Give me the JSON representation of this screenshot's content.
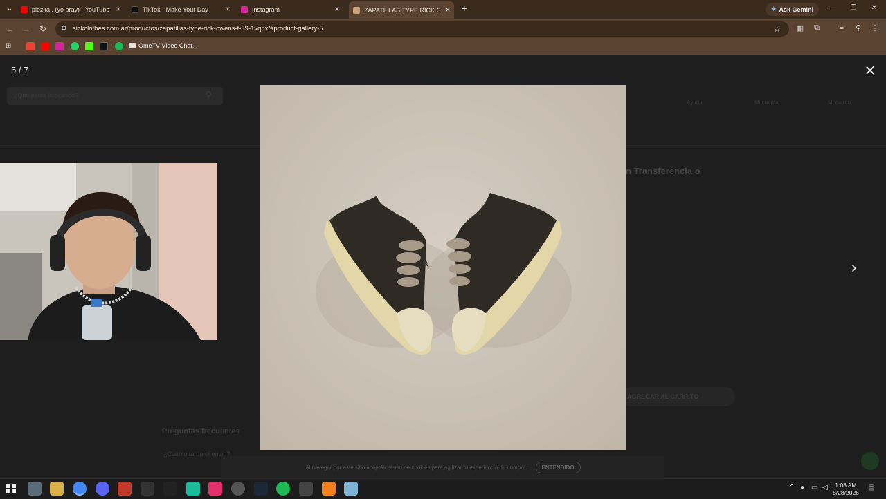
{
  "browser": {
    "tabs": [
      {
        "title": "piezita . (yo pray) - YouTube",
        "icon": "youtube-icon",
        "color": "#ff0000"
      },
      {
        "title": "TikTok - Make Your Day",
        "icon": "tiktok-icon",
        "color": "#111111"
      },
      {
        "title": "Instagram",
        "icon": "instagram-icon",
        "color": "#d6249f"
      },
      {
        "title": "ZAPATILLAS TYPE RICK OWENS",
        "icon": "sickclothes-icon",
        "color": "#c9a27a"
      }
    ],
    "active_tab_index": 3,
    "new_tab": "+",
    "gemini_label": "Ask Gemini",
    "url": "sickclothes.com.ar/productos/zapatillas-type-rick-owens-t-39-1vqnx/#product-gallery-5",
    "bookmarks": [
      {
        "name": "gmail-bookmark",
        "color": "#ea4335"
      },
      {
        "name": "youtube-bookmark",
        "color": "#ff0000"
      },
      {
        "name": "instagram-bookmark",
        "color": "#d6249f"
      },
      {
        "name": "whatsapp-bookmark",
        "color": "#25d366"
      },
      {
        "name": "kick-bookmark",
        "color": "#53fc18"
      },
      {
        "name": "tiktok-bookmark",
        "color": "#111111"
      },
      {
        "name": "spotify-bookmark",
        "color": "#1db954"
      }
    ],
    "bookmark_ometv": "OmeTV Video Chat..."
  },
  "page_ghost": {
    "search_placeholder": "¿Qué estás buscando?",
    "help": "Ayuda",
    "account": "Mi cuenta",
    "cart": "Mi carrito",
    "transfer": "n Transferencia o",
    "add_to_cart": "AGREGAR AL CARRITO",
    "faq": "Preguntas frecuentes",
    "faq_q1": "¿Cuánto tarda el envío?"
  },
  "gallery": {
    "counter": "5 / 7",
    "close": "✕",
    "next": "›"
  },
  "cookie_bar": {
    "text": "Al navegar por este sitio aceptás el uso de cookies para agilizar tu experiencia de compra.",
    "button": "ENTENDIDO"
  },
  "taskbar": {
    "time": "1:08 AM",
    "date": "8/28/2026",
    "apps": [
      {
        "name": "start-button",
        "color": "#3aa0ff"
      },
      {
        "name": "file-explorer-app",
        "color": "#d9b04a"
      },
      {
        "name": "chrome-app",
        "color": "#4285f4"
      },
      {
        "name": "discord-app",
        "color": "#5865f2"
      },
      {
        "name": "voicemeeter-app",
        "color": "#c0392b"
      },
      {
        "name": "epic-games-app",
        "color": "#333333"
      },
      {
        "name": "capcut-app",
        "color": "#222222"
      },
      {
        "name": "tiktok-live-app",
        "color": "#1abc9c"
      },
      {
        "name": "tiktok-app",
        "color": "#e1306c"
      },
      {
        "name": "obs-app",
        "color": "#555555"
      },
      {
        "name": "steam-app",
        "color": "#1b2838"
      },
      {
        "name": "spotify-app",
        "color": "#1db954"
      },
      {
        "name": "game-app",
        "color": "#444444"
      },
      {
        "name": "cloudflare-app",
        "color": "#f38020"
      },
      {
        "name": "notes-app",
        "color": "#7fb3d5"
      }
    ]
  }
}
